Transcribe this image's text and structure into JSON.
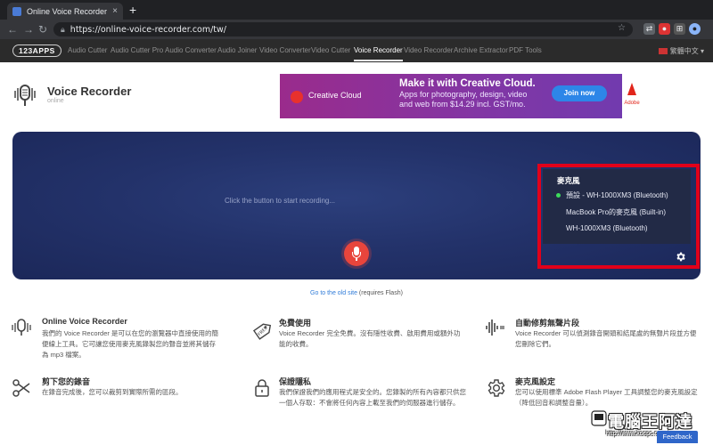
{
  "browser": {
    "tab_title": "Online Voice Recorder - 透過瀏",
    "tab_close": "×",
    "new_tab": "+",
    "url": "https://online-voice-recorder.com/tw/"
  },
  "site_nav": {
    "logo": "123APPS",
    "items": [
      {
        "label": "Audio Cutter"
      },
      {
        "label": "Audio Cutter Pro"
      },
      {
        "label": "Audio Converter"
      },
      {
        "label": "Audio Joiner"
      },
      {
        "label": "Video Converter"
      },
      {
        "label": "Video Cutter"
      },
      {
        "label": "Voice Recorder"
      },
      {
        "label": "Video Recorder"
      },
      {
        "label": "Archive Extractor"
      },
      {
        "label": "PDF Tools"
      }
    ],
    "active_index": 6,
    "language": "繁體中文"
  },
  "app": {
    "title": "Voice Recorder",
    "subtitle": "online"
  },
  "ad": {
    "brand": "Creative Cloud",
    "headline": "Make it with Creative Cloud.",
    "body": "Apps for photography, design, video and web from $14.29 incl. GST/mo.",
    "button": "Join now",
    "sponsor": "Adobe"
  },
  "recorder": {
    "hint": "Click the button to start recording...",
    "microphone_label": "麥克風",
    "options": [
      {
        "label": "預設 - WH-1000XM3 (Bluetooth)",
        "selected": true
      },
      {
        "label": "MacBook Pro的麥克風 (Built-in)",
        "selected": false
      },
      {
        "label": "WH-1000XM3 (Bluetooth)",
        "selected": false
      }
    ]
  },
  "old_site": {
    "link": "Go to the old site",
    "note": " (requires Flash)"
  },
  "features": [
    {
      "icon": "voice-waveform-icon",
      "title": "Online Voice Recorder",
      "desc": "我們的 Voice Recorder 是可以在您的瀏覽器中直接使用的簡便線上工具。它可讓您使用麥克風錄製您的聲音並將其儲存為 mp3 檔案。"
    },
    {
      "icon": "free-tag-icon",
      "title": "免費使用",
      "desc": "Voice Recorder 完全免費。沒有隱性收費、啟用費用或額外功能的收費。"
    },
    {
      "icon": "silence-trim-icon",
      "title": "自動修剪無聲片段",
      "desc": "Voice Recorder 可以偵測錄音開頭和結尾處的無聲片段並方便您刪除它們。"
    },
    {
      "icon": "scissors-icon",
      "title": "剪下您的錄音",
      "desc": "在錄音完成後，您可以裁剪到實際所需的區段。"
    },
    {
      "icon": "padlock-icon",
      "title": "保證隱私",
      "desc": "我們保證我們的應用程式是安全的。您錄製的所有內容都只供您一個人存取：不會將任何內容上載至我們的伺服器進行儲存。"
    },
    {
      "icon": "gear-icon",
      "title": "麥克風設定",
      "desc": "您可以使用標準 Adobe Flash Player 工具調整您的麥克風設定（降低回音和調整音量）。"
    }
  ],
  "feedback": "Feedback",
  "watermark": {
    "text": "電腦王阿達",
    "url": "http://www.kocpc.com.tw"
  }
}
